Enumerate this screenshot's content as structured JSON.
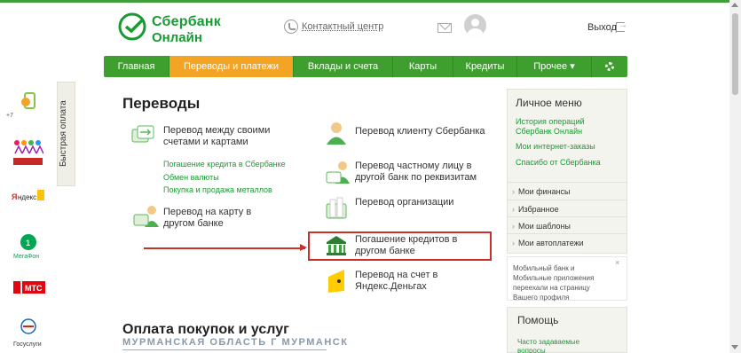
{
  "header": {
    "logo_line1": "Сбербанк",
    "logo_line2": "Онлайн",
    "contact_center": "Контактный центр",
    "logout": "Выход"
  },
  "nav": {
    "items": [
      "Главная",
      "Переводы и платежи",
      "Вклады и счета",
      "Карты",
      "Кредиты",
      "Прочее ▾"
    ],
    "active_index": 1
  },
  "quick_pay": {
    "label": "Быстрая оплата",
    "tele2_label": "+7",
    "yandex_label": "Яндекс",
    "megafon_label": "МегаФон",
    "mts_label": "МТС",
    "gosuslugi_label": "Госуслуги"
  },
  "main": {
    "title": "Переводы",
    "items": [
      {
        "text": "Перевод между своими счетами и картами",
        "icon": "cards-transfer-icon"
      },
      {
        "text": "Перевод клиенту Сбербанка",
        "icon": "sber-client-icon"
      },
      {
        "text": "Перевод частному лицу в другой банк по реквизитам",
        "icon": "private-person-icon"
      },
      {
        "text": "Перевод организации",
        "icon": "organization-icon"
      },
      {
        "text": "Перевод на карту в другом банке",
        "icon": "card-other-bank-icon"
      },
      {
        "text": "Погашение кредитов в другом банке",
        "icon": "bank-building-icon"
      },
      {
        "text": "Перевод на счет в Яндекс.Деньгах",
        "icon": "yandex-money-icon"
      }
    ],
    "sub_links": [
      "Погашение кредита в Сбербанке",
      "Обмен валюты",
      "Покупка и продажа металлов"
    ],
    "payments_title": "Оплата покупок и услуг",
    "region": "МУРМАНСКАЯ ОБЛАСТЬ Г МУРМАНСК"
  },
  "personal_menu": {
    "title": "Личное меню",
    "links": [
      "История операций Сбербанк Онлайн",
      "Мои интернет-заказы",
      "Спасибо от Сбербанка"
    ],
    "rows": [
      "Мои финансы",
      "Избранное",
      "Мои шаблоны",
      "Мои автоплатежи"
    ]
  },
  "promo": {
    "text": "Мобильный банк и Мобильные приложения переехали на страницу Вашего профиля",
    "close": "×"
  },
  "help": {
    "title": "Помощь",
    "link": "Часто задаваемые вопросы"
  },
  "colors": {
    "brand_green": "#1a9a33",
    "nav_green": "#3e9e2e",
    "nav_active": "#f4a424",
    "highlight_red": "#c9302c"
  }
}
